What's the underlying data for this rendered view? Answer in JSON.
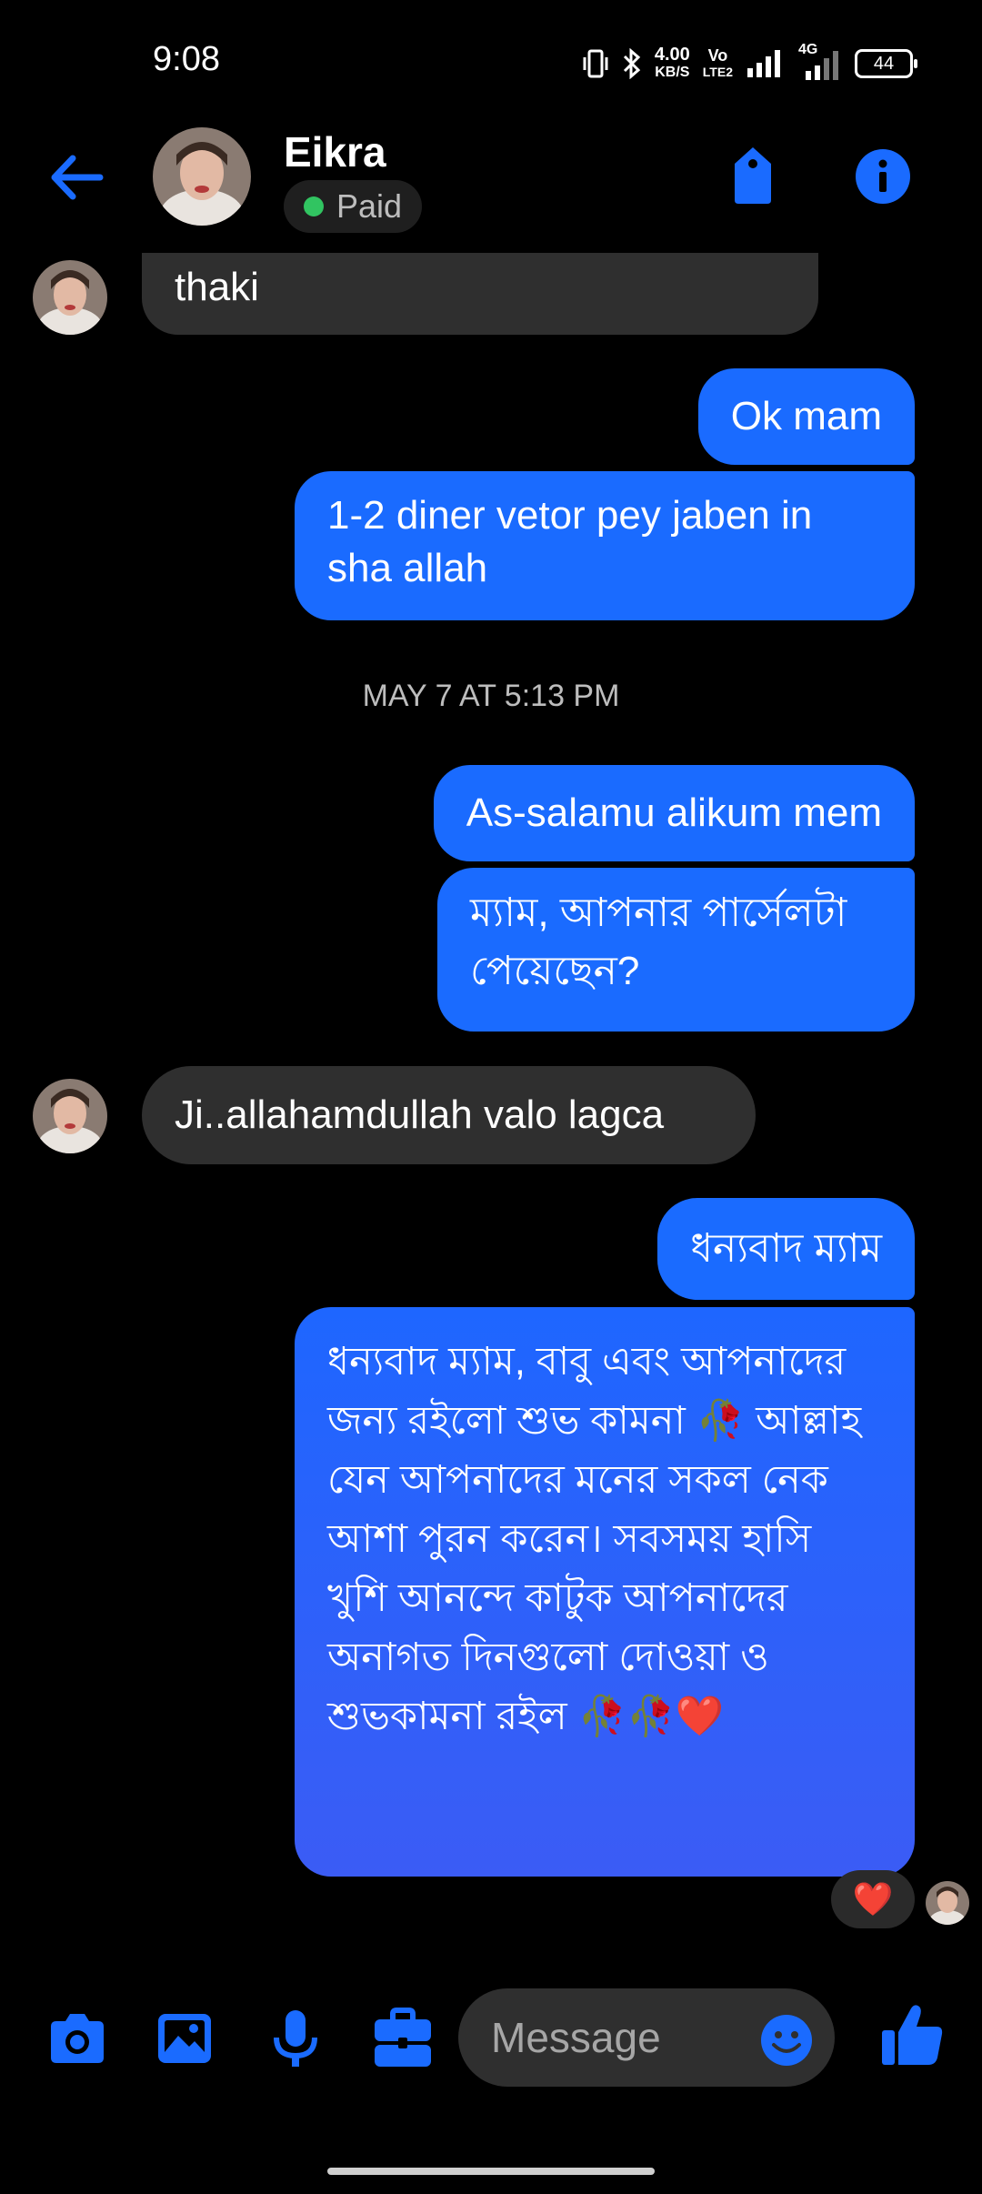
{
  "status_bar": {
    "time": "9:08",
    "speed_value": "4.00",
    "speed_unit": "KB/S",
    "volte_top": "Vo",
    "volte_bottom": "LTE2",
    "network": "4G",
    "battery": "44"
  },
  "header": {
    "contact_name": "Eikra",
    "badge_label": "Paid",
    "back_icon": "arrow-left-icon",
    "tag_icon": "tag-icon",
    "info_icon": "info-icon"
  },
  "messages": [
    {
      "direction": "in",
      "text": "thaki"
    },
    {
      "direction": "out",
      "text": "Ok mam"
    },
    {
      "direction": "out",
      "text": "1-2 diner vetor pey jaben in sha allah"
    },
    {
      "direction": "out",
      "text": "As-salamu alikum mem"
    },
    {
      "direction": "out",
      "text": "ম্যাম, আপনার পার্সেলটা পেয়েছেন?"
    },
    {
      "direction": "in",
      "text": "Ji..allahamdullah  valo lagca"
    },
    {
      "direction": "out",
      "text": "ধন্যবাদ ম্যাম"
    },
    {
      "direction": "out",
      "text": "ধন্যবাদ ম্যাম, বাবু এবং আপনাদের জন্য রইলো শুভ কামনা 🥀 আল্লাহ যেন আপনাদের মনের সকল নেক আশা পুরন করেন। সবসময় হাসি খুশি আনন্দে কাটুক আপনাদের অনাগত দিনগুলো দোওয়া ও শুভকামনা রইল 🥀🥀❤️"
    }
  ],
  "timestamp": "MAY 7 AT 5:13 PM",
  "reaction": "❤️",
  "composer": {
    "placeholder": "Message",
    "icons": [
      "camera-icon",
      "gallery-icon",
      "microphone-icon",
      "briefcase-icon",
      "emoji-icon",
      "thumbs-up-icon"
    ]
  },
  "colors": {
    "accent": "#1a6bff",
    "incoming_bubble": "#2f2f2f",
    "online_dot": "#31c461"
  }
}
